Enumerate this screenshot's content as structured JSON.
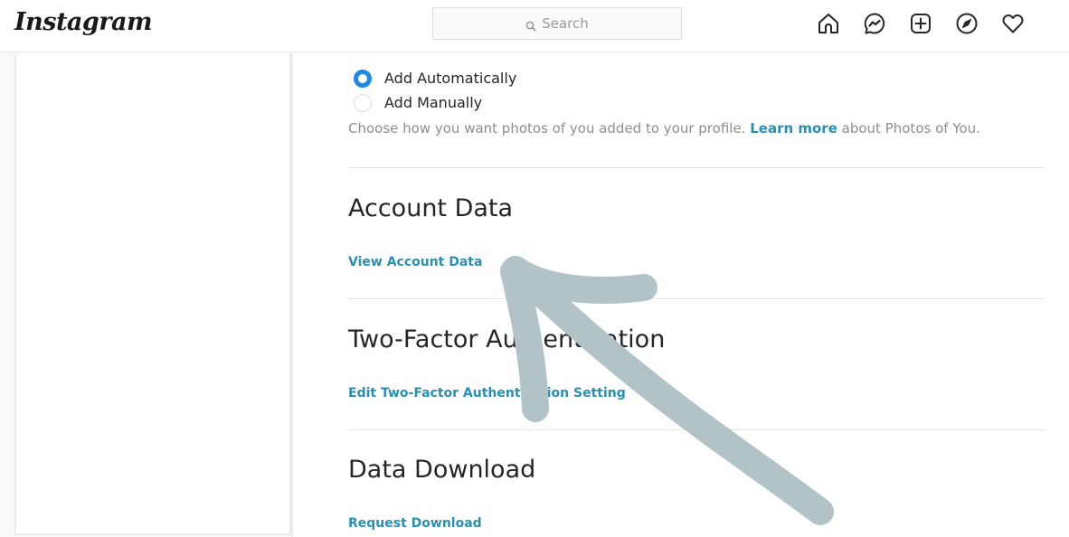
{
  "header": {
    "logo": "Instagram",
    "search": {
      "placeholder": "Search",
      "icon": "search-icon"
    },
    "nav_icons": [
      {
        "name": "home-icon",
        "label": "Home"
      },
      {
        "name": "messenger-icon",
        "label": "Direct"
      },
      {
        "name": "new-post-icon",
        "label": "New Post"
      },
      {
        "name": "explore-icon",
        "label": "Explore"
      },
      {
        "name": "activity-heart-icon",
        "label": "Activity"
      }
    ]
  },
  "photos_of_you": {
    "options": [
      {
        "label": "Add Automatically",
        "selected": true
      },
      {
        "label": "Add Manually",
        "selected": false
      }
    ],
    "help_prefix": "Choose how you want photos of you added to your profile. ",
    "help_link": "Learn more",
    "help_suffix": " about Photos of You."
  },
  "sections": [
    {
      "title": "Account Data",
      "link": "View Account Data"
    },
    {
      "title": "Two-Factor Authentication",
      "link": "Edit Two-Factor Authentication Setting"
    },
    {
      "title": "Data Download",
      "link": "Request Download"
    }
  ],
  "annotation": {
    "type": "arrow",
    "color": "#b2c3c8",
    "points_to": "View Account Data"
  },
  "colors": {
    "link": "#2b8fb0",
    "radio_selected": "#1f8ae0",
    "arrow": "#b2c3c8"
  }
}
